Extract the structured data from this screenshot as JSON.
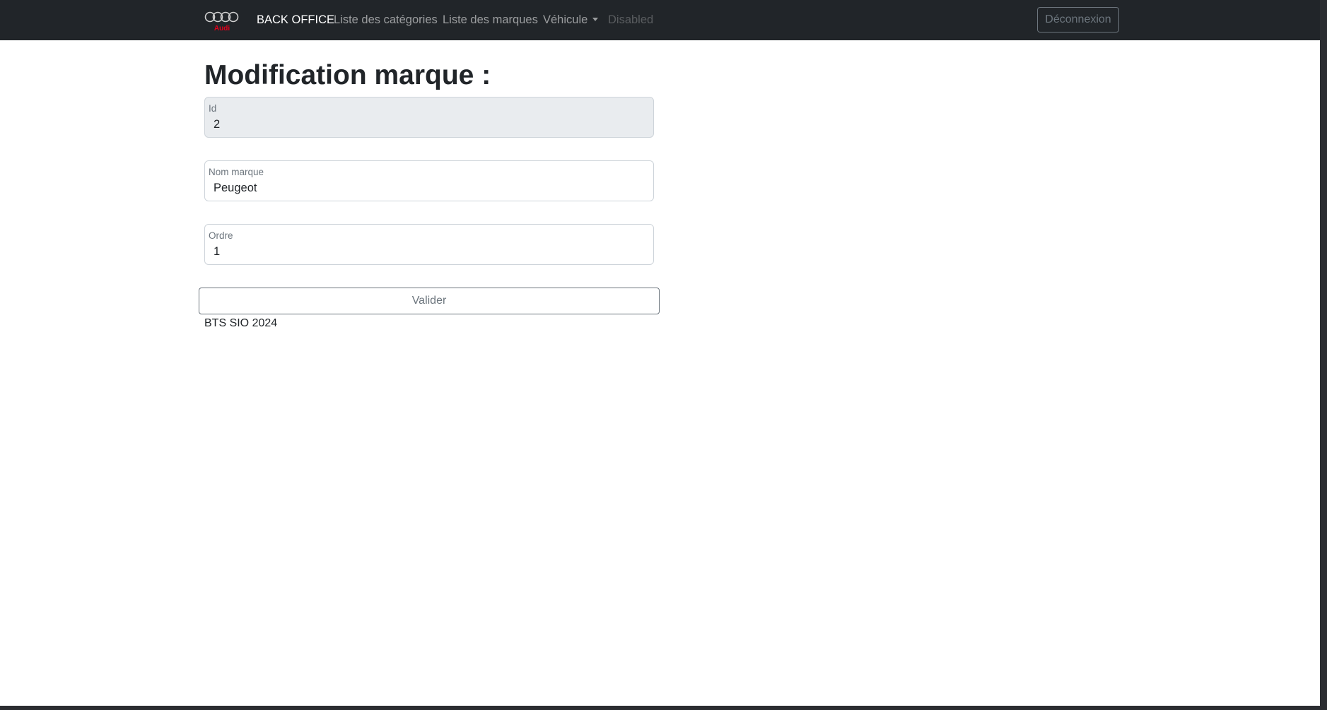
{
  "navbar": {
    "brand": "BACK OFFICE",
    "logo_text": "Audi",
    "logo_icon": "audi-rings-logo",
    "links": [
      {
        "label": "Liste des catégories"
      },
      {
        "label": "Liste des marques"
      },
      {
        "label": "Véhicule"
      },
      {
        "label": "Disabled"
      }
    ],
    "logout_label": "Déconnexion"
  },
  "page": {
    "title": "Modification marque :"
  },
  "form": {
    "id": {
      "label": "Id",
      "value": "2"
    },
    "nom": {
      "label": "Nom marque",
      "value": "Peugeot"
    },
    "ordre": {
      "label": "Ordre",
      "value": "1"
    },
    "submit_label": "Valider"
  },
  "footer": {
    "text": "BTS SIO 2024"
  },
  "colors": {
    "navbar_bg": "#212529",
    "readonly_bg": "#e9ecef",
    "border": "#ced4da",
    "logo_red": "#e3001b"
  }
}
